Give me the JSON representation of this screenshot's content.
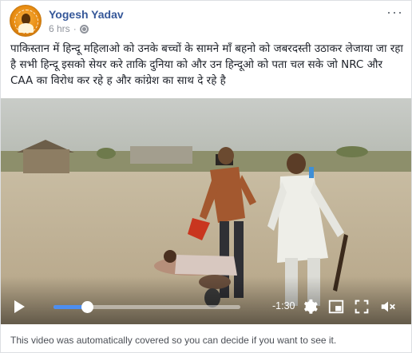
{
  "post": {
    "author": "Yogesh Yadav",
    "time": "6 hrs",
    "more_label": "···",
    "text": "पाकिस्तान में हिन्दू महिलाओ को उनके बच्चों के सामने माँ बहनो को जबरदस्ती उठाकर लेजाया जा रहा है सभी हिन्दू इसको सेयर करे ताकि दुनिया को और उन हिन्दूओ को पता चल सके जो NRC और CAA का विरोध कर रहे ह और कांग्रेश का साथ दे रहे है",
    "privacy_icon": "globe-icon",
    "avatar_icon": "page-logo-avatar"
  },
  "video": {
    "time_remaining": "-1:30",
    "progress_fraction": 0.18,
    "play_icon": "play-icon",
    "settings_icon": "gear-icon",
    "pip_icon": "picture-in-picture-icon",
    "fullscreen_icon": "fullscreen-icon",
    "volume_icon": "volume-muted-icon"
  },
  "notice": "This video was automatically covered so you can decide if you want to see it.",
  "colors": {
    "author_link": "#365899",
    "meta_gray": "#90949c",
    "progress_blue": "#4d8ef0"
  }
}
